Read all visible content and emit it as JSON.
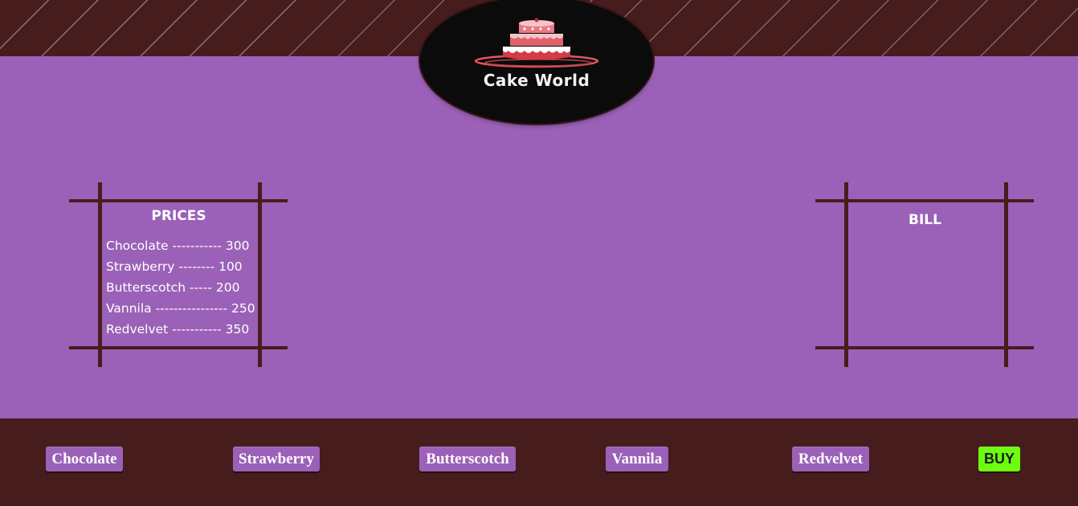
{
  "colors": {
    "page_background": "#9b61b8",
    "band_background": "#461c1d",
    "frame_color": "#4a1b1e",
    "button_background": "#9b61b8",
    "buy_button_background": "#6dfe0f",
    "logo_background": "#0b0b0b"
  },
  "header": {
    "logo_icon": "cake-icon",
    "logo_text": "Cake World"
  },
  "prices": {
    "title": "PRICES",
    "items": [
      "Chocolate ----------- 300",
      "Strawberry -------- 100",
      "Butterscotch ----- 200",
      "Vannila ---------------- 250",
      "Redvelvet ----------- 350"
    ]
  },
  "bill": {
    "title": "BILL"
  },
  "buttons": {
    "chocolate": "Chocolate",
    "strawberry": "Strawberry",
    "butterscotch": "Butterscotch",
    "vannila": "Vannila",
    "redvelvet": "Redvelvet",
    "buy": "BUY"
  }
}
